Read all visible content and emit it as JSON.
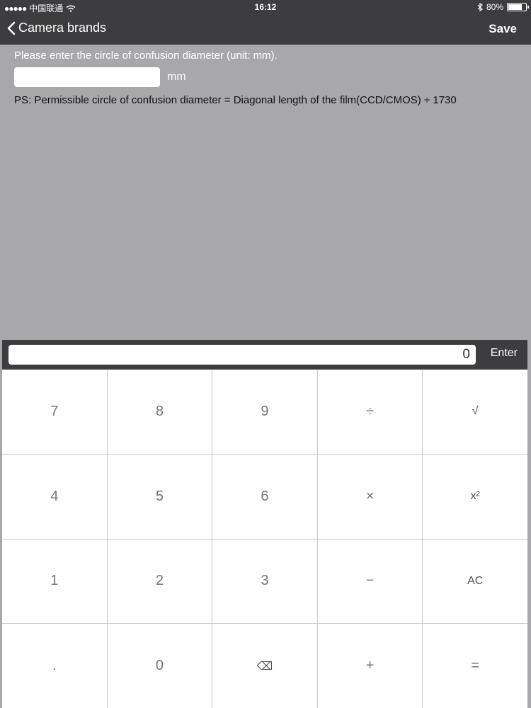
{
  "status": {
    "carrier": "中国联通",
    "time": "16:12",
    "battery": "80%",
    "battery_level": 0.8
  },
  "nav": {
    "back_label": "Camera brands",
    "save_label": "Save"
  },
  "form": {
    "prompt": "Please enter the circle of confusion diameter (unit: mm).",
    "value": "",
    "unit": "mm",
    "note": "PS: Permissible circle of confusion diameter = Diagonal length of the film(CCD/CMOS) ÷ 1730"
  },
  "calculator": {
    "display": "0",
    "enter_label": "Enter",
    "keys": [
      "7",
      "8",
      "9",
      "÷",
      "√",
      "4",
      "5",
      "6",
      "×",
      "x²",
      "1",
      "2",
      "3",
      "−",
      "AC",
      ".",
      "0",
      "⌫",
      "+",
      "="
    ]
  }
}
